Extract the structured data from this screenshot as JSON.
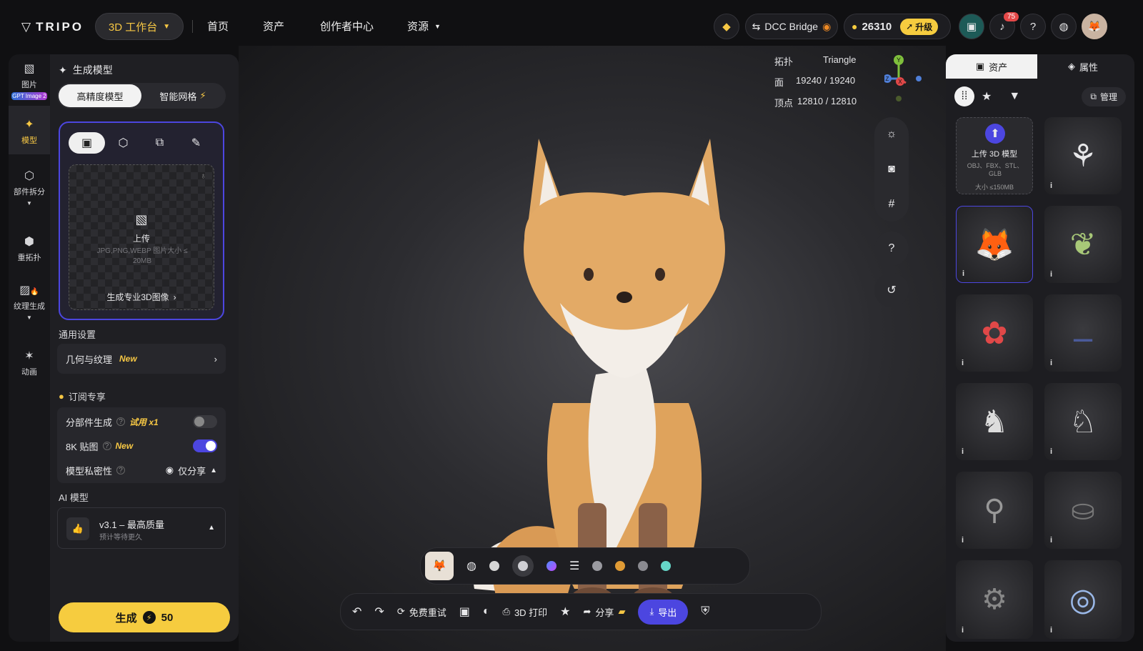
{
  "topbar": {
    "logo": "TRIPO",
    "workbench_label": "3D 工作台",
    "nav": [
      "首页",
      "资产",
      "创作者中心",
      "资源"
    ],
    "dcc_label": "DCC Bridge",
    "credits": "26310",
    "upgrade_label": "升级",
    "notif_count": "75"
  },
  "rail": {
    "items": [
      {
        "label": "图片",
        "sub": "GPT Image 2"
      },
      {
        "label": "模型"
      },
      {
        "label": "部件拆分"
      },
      {
        "label": "重拓扑"
      },
      {
        "label": "纹理生成"
      },
      {
        "label": "动画"
      }
    ]
  },
  "panel": {
    "title": "生成模型",
    "tabs": [
      "高精度模型",
      "智能网格"
    ],
    "upload_label": "上传",
    "upload_hint": "JPG,PNG,WEBP 图片大小 ≤ 20MB",
    "pro_image_link": "生成专业3D图像",
    "general_settings": "通用设置",
    "geometry_texture": "几何与纹理",
    "new_tag": "New",
    "subscription": "订阅专享",
    "part_gen": "分部件生成",
    "trial_tag": "试用 x1",
    "texture_8k": "8K 贴图",
    "privacy": "模型私密性",
    "privacy_value": "仅分享",
    "ai_model_title": "AI 模型",
    "ai_model_name": "v3.1 – 最高质量",
    "ai_model_note": "预计等待更久",
    "generate_label": "生成",
    "generate_cost": "50"
  },
  "viewport": {
    "topology_label": "拓扑",
    "topology_value": "Triangle",
    "faces_label": "面",
    "faces_value": "19240 / 19240",
    "vertices_label": "顶点",
    "vertices_value": "12810 / 12810",
    "axis_y": "Y",
    "axis_z": "Z",
    "axis_x": "X"
  },
  "bottombar": {
    "retry_label": "免费重试",
    "print_label": "3D 打印",
    "share_label": "分享",
    "export_label": "导出"
  },
  "rpanel": {
    "tabs": [
      "资产",
      "属性"
    ],
    "manage_label": "管理",
    "upload_title": "上传 3D 模型",
    "upload_formats": "OBJ、FBX、STL、GLB",
    "upload_size": "大小 ≤150MB"
  },
  "colors": {
    "accent_yellow": "#f6cc3f",
    "accent_purple": "#4c46e0",
    "panel_bg": "#1f1f23"
  }
}
